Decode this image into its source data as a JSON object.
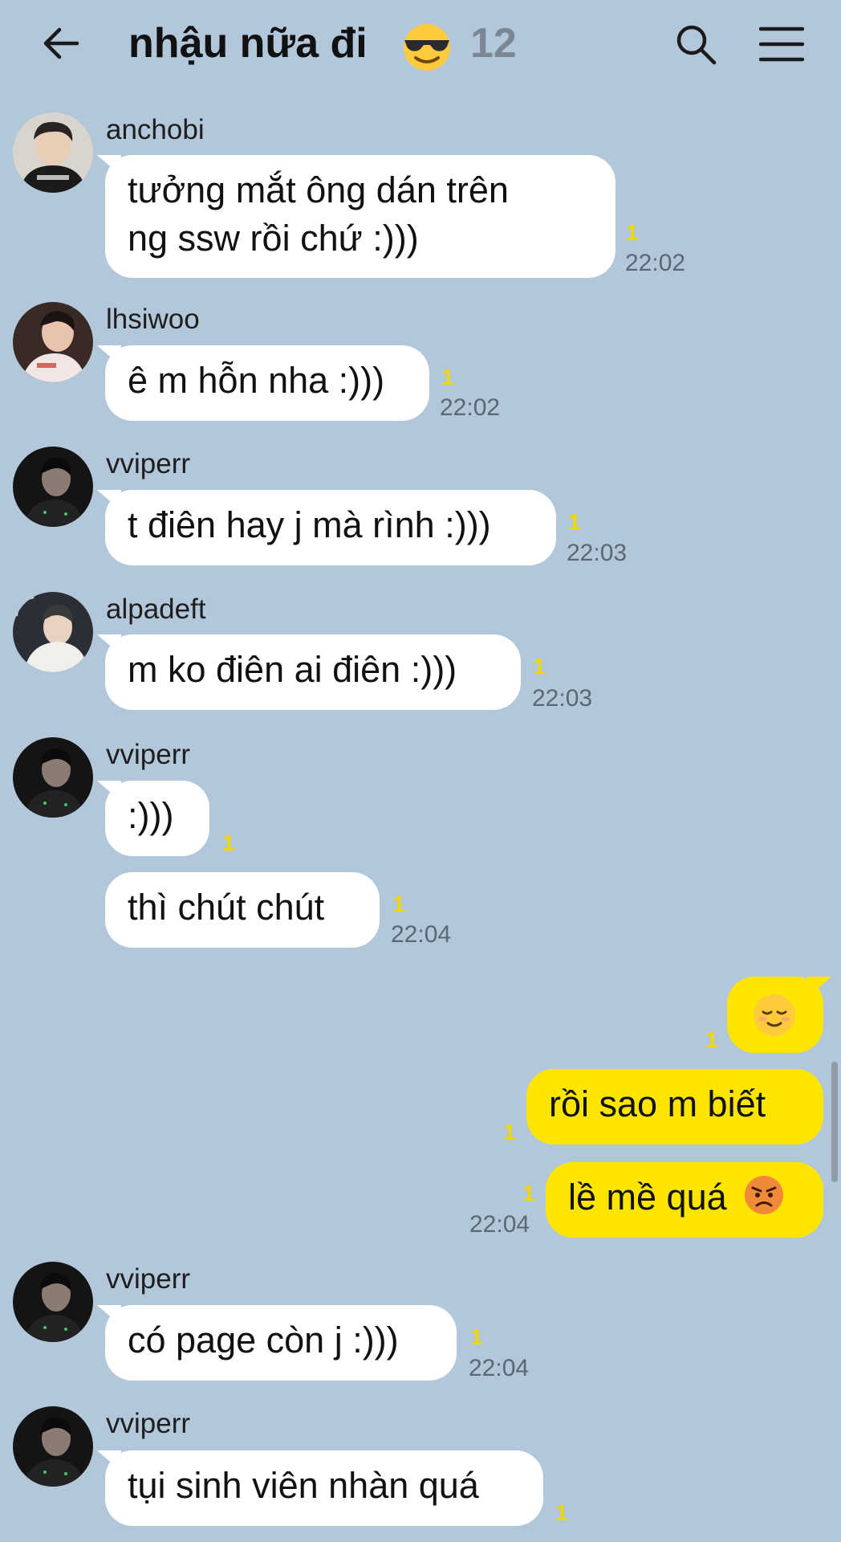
{
  "header": {
    "back_icon": "arrow-left-icon",
    "title": "nhậu nữa đi",
    "title_emoji": "sunglasses-face-emoji",
    "member_count": "12",
    "search_icon": "search-icon",
    "menu_icon": "hamburger-menu-icon"
  },
  "colors": {
    "background": "#b2c7d9",
    "incoming_bubble": "#ffffff",
    "outgoing_bubble": "#fee500",
    "unread_count": "#f0d800",
    "timestamp": "#5b6873"
  },
  "messages": [
    {
      "sender": "anchobi",
      "text_line1": "tưởng mắt ông dán trên",
      "text_line2": "ng ssw rồi chứ :)))",
      "unread": "1",
      "time": "22:02"
    },
    {
      "sender": "lhsiwoo",
      "text": "ê m hỗn nha :)))",
      "unread": "1",
      "time": "22:02"
    },
    {
      "sender": "vviperr",
      "text": "t điên hay j mà rình :)))",
      "unread": "1",
      "time": "22:03"
    },
    {
      "sender": "alpadeft",
      "text": "m ko điên ai điên :)))",
      "unread": "1",
      "time": "22:03"
    },
    {
      "sender": "vviperr",
      "text": ":)))",
      "unread": "1"
    },
    {
      "text": "thì chút chút",
      "unread": "1",
      "time": "22:04"
    },
    {
      "me": true,
      "emoji": "relieved-face-emoji",
      "unread": "1"
    },
    {
      "me": true,
      "text": "rồi sao m biết",
      "unread": "1"
    },
    {
      "me": true,
      "text": "lề mề quá",
      "emoji": "angry-face-emoji",
      "unread": "1",
      "time": "22:04"
    },
    {
      "sender": "vviperr",
      "text": "có page còn j :)))",
      "unread": "1",
      "time": "22:04"
    },
    {
      "sender": "vviperr",
      "text": "tụi sinh viên nhàn quá",
      "unread": "1"
    }
  ]
}
